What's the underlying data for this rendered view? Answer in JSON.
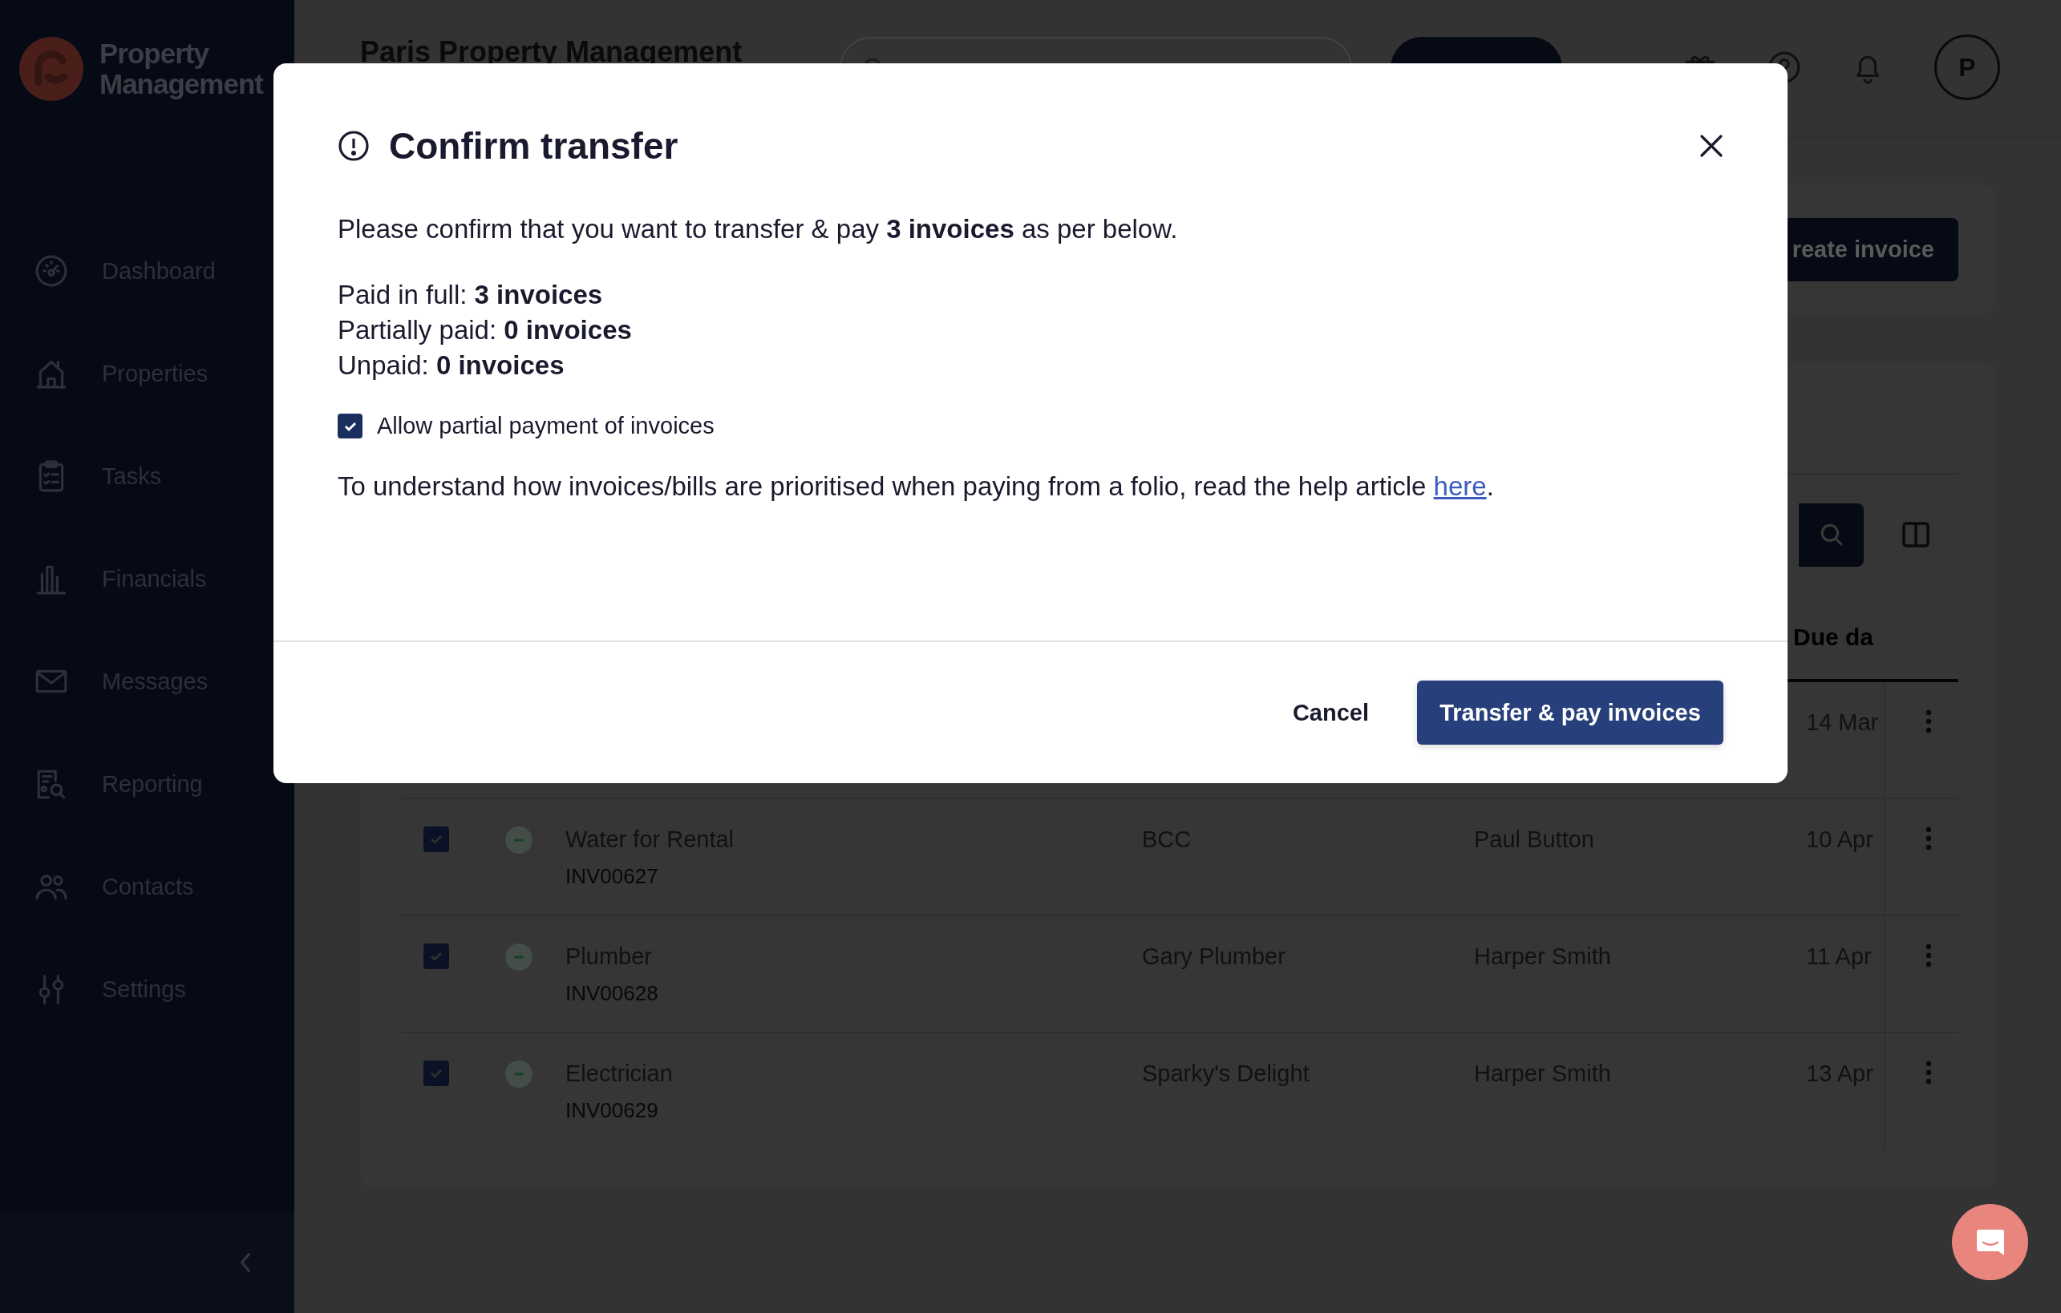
{
  "logo": {
    "lines": [
      "Property",
      "Management"
    ]
  },
  "sidebar": {
    "items": [
      {
        "label": "Dashboard",
        "kind": "gauge"
      },
      {
        "label": "Properties",
        "kind": "house"
      },
      {
        "label": "Tasks",
        "kind": "clipboard"
      },
      {
        "label": "Financials",
        "kind": "chart"
      },
      {
        "label": "Messages",
        "kind": "mail"
      },
      {
        "label": "Reporting",
        "kind": "report"
      },
      {
        "label": "Contacts",
        "kind": "people"
      },
      {
        "label": "Settings",
        "kind": "sliders"
      }
    ]
  },
  "header": {
    "title": "Paris Property Management",
    "avatar": "P"
  },
  "actions": {
    "create_button": "reate invoice"
  },
  "table": {
    "columns": [
      {
        "label": "Due da"
      }
    ],
    "rows": [
      {
        "due": "14 Mar"
      },
      {
        "title": "Water for Rental",
        "reference": "INV00627",
        "supplier": "BCC",
        "owner": "Paul Button",
        "due": "10 Apr",
        "checked": true
      },
      {
        "title": "Plumber",
        "reference": "INV00628",
        "supplier": "Gary Plumber",
        "owner": "Harper Smith",
        "due": "11 Apr",
        "checked": true
      },
      {
        "title": "Electrician",
        "reference": "INV00629",
        "supplier": "Sparky's Delight",
        "owner": "Harper Smith",
        "due": "13 Apr",
        "checked": true
      }
    ]
  },
  "modal": {
    "title": "Confirm transfer",
    "intro": "Please confirm that you want to transfer & pay **3 invoices** as per below.",
    "summary": [
      "Paid in full: **3 invoices**",
      "Partially paid: **0 invoices**",
      "Unpaid: **0 invoices**"
    ],
    "checkbox": {
      "label": "Allow partial payment of invoices",
      "checked": true
    },
    "help": {
      "text": "To understand how invoices/bills are prioritised when paying from a folio, read the help article",
      "link": "here",
      "after": "."
    },
    "buttons": {
      "cancel": "Cancel",
      "confirm": "Transfer & pay invoices"
    }
  }
}
